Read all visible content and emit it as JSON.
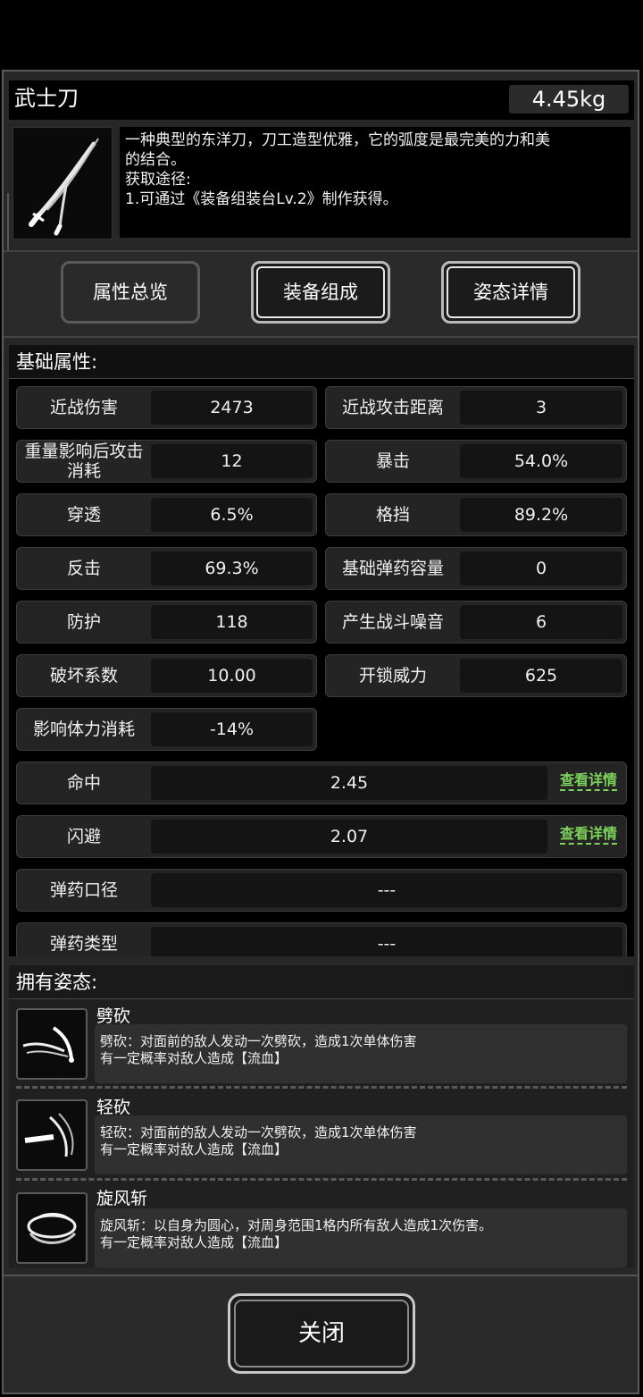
{
  "item": {
    "name": "武士刀",
    "weight": "4.45kg",
    "icon": "katana-icon",
    "description_lines": [
      "一种典型的东洋刀，刀工造型优雅，它的弧度是最完美的力和美",
      "的结合。",
      "获取途径:",
      "1.可通过《装备组装台Lv.2》制作获得。"
    ]
  },
  "tabs": [
    "属性总览",
    "装备组成",
    "姿态详情"
  ],
  "basic_header": "基础属性:",
  "attributes": [
    {
      "label": "近战伤害",
      "value": "2473"
    },
    {
      "label": "近战攻击距离",
      "value": "3"
    },
    {
      "label": "重量影响后攻击消耗",
      "value": "12"
    },
    {
      "label": "暴击",
      "value": "54.0%"
    },
    {
      "label": "穿透",
      "value": "6.5%"
    },
    {
      "label": "格挡",
      "value": "89.2%"
    },
    {
      "label": "反击",
      "value": "69.3%"
    },
    {
      "label": "基础弹药容量",
      "value": "0"
    },
    {
      "label": "防护",
      "value": "118"
    },
    {
      "label": "产生战斗噪音",
      "value": "6"
    },
    {
      "label": "破坏系数",
      "value": "10.00"
    },
    {
      "label": "开锁威力",
      "value": "625"
    },
    {
      "label": "影响体力消耗",
      "value": "-14%"
    }
  ],
  "wide_attributes": [
    {
      "label": "命中",
      "value": "2.45",
      "link": "查看详情"
    },
    {
      "label": "闪避",
      "value": "2.07",
      "link": "查看详情"
    },
    {
      "label": "弹药口径",
      "value": "---"
    },
    {
      "label": "弹药类型",
      "value": "---"
    }
  ],
  "stance_header": "拥有姿态:",
  "stances": [
    {
      "name": "劈砍",
      "icon": "slash-icon",
      "desc1": "劈砍：对面前的敌人发动一次劈砍，造成1次单体伤害",
      "desc2": "有一定概率对敌人造成【流血】"
    },
    {
      "name": "轻砍",
      "icon": "light-slash-icon",
      "desc1": "轻砍：对面前的敌人发动一次劈砍，造成1次单体伤害",
      "desc2": "有一定概率对敌人造成【流血】"
    },
    {
      "name": "旋风斩",
      "icon": "whirlwind-icon",
      "desc1": "旋风斩：以自身为圆心，对周身范围1格内所有敌人造成1次伤害。",
      "desc2": "有一定概率对敌人造成【流血】"
    }
  ],
  "close_label": "关闭",
  "colors": {
    "link": "#7dd35a",
    "panel": "#272727"
  }
}
